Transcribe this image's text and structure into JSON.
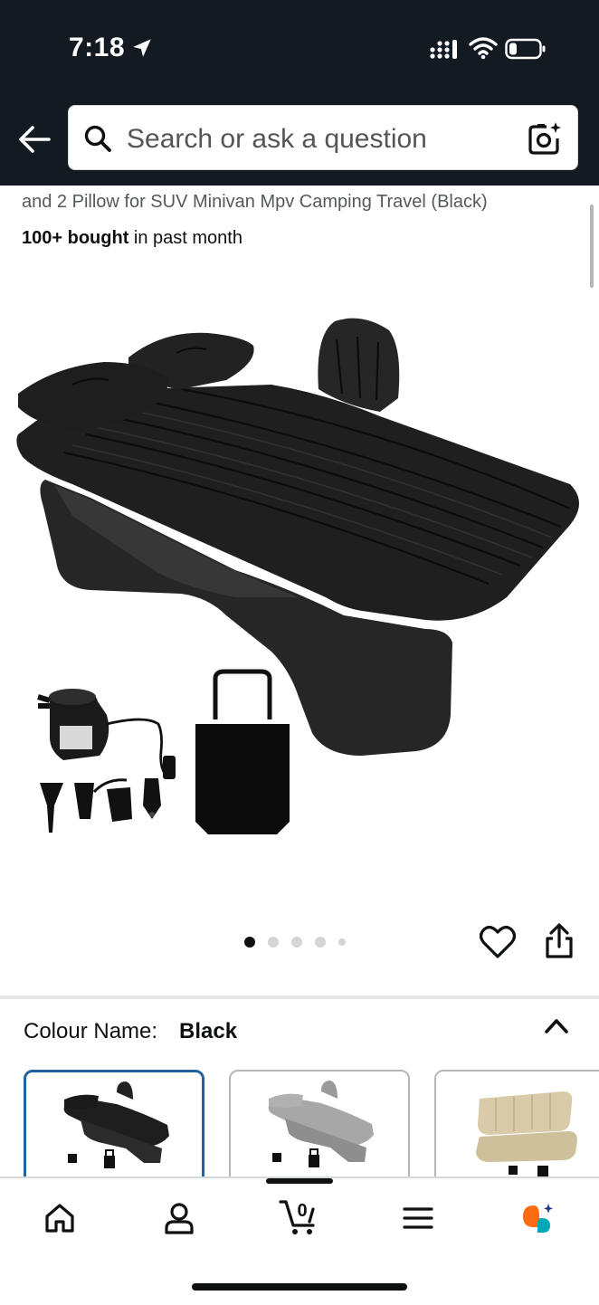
{
  "status_bar": {
    "time": "7:18"
  },
  "search": {
    "placeholder": "Search or ask a question"
  },
  "product": {
    "title_visible": "and 2 Pillow for SUV Minivan Mpv Camping Travel (Black)",
    "bought_bold": "100+ bought",
    "bought_rest": " in past month"
  },
  "gallery": {
    "total_images": 5,
    "active_index": 0
  },
  "variation": {
    "label": "Colour Name:",
    "selected": "Black",
    "swatches": [
      {
        "name": "black",
        "color": "#1c1c1c",
        "selected": true
      },
      {
        "name": "grey",
        "color": "#8f8f8f",
        "selected": false
      },
      {
        "name": "beige",
        "color": "#d9cbaa",
        "selected": false
      }
    ]
  },
  "bottom_nav": {
    "items": [
      "home-icon",
      "account-icon",
      "cart-icon",
      "menu-icon",
      "rufus-icon"
    ],
    "cart_count": "0"
  },
  "colors": {
    "header_bg": "#131a22",
    "accent_blue": "#2162a1",
    "rufus_orange": "#ff6a13",
    "rufus_teal": "#00a8b5"
  }
}
